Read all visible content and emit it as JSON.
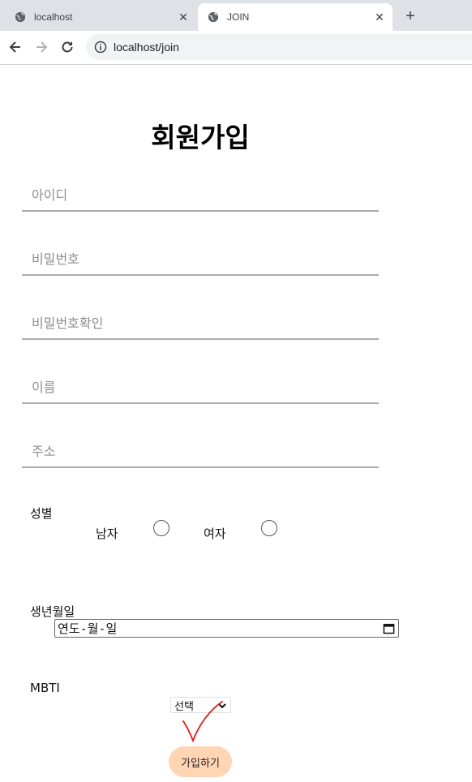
{
  "browser": {
    "tabs": [
      {
        "title": "localhost",
        "icon": "globe-icon",
        "active": false
      },
      {
        "title": "JOIN",
        "icon": "globe-icon",
        "active": true
      }
    ],
    "address": "localhost/join"
  },
  "form": {
    "title": "회원가입",
    "inputs": {
      "id_placeholder": "아이디",
      "password_placeholder": "비밀번호",
      "password_confirm_placeholder": "비밀번호확인",
      "name_placeholder": "이름",
      "address_placeholder": "주소"
    },
    "gender": {
      "label": "성별",
      "male": "남자",
      "female": "여자"
    },
    "birthdate": {
      "label": "생년월일",
      "placeholder": "연도-월-일"
    },
    "mbti": {
      "label": "MBTI",
      "selected": "선택"
    },
    "submit_label": "가입하기"
  },
  "colors": {
    "submit_bg": "#ffd5b4",
    "annotation": "#e21b1b",
    "underline": "#adadad"
  }
}
